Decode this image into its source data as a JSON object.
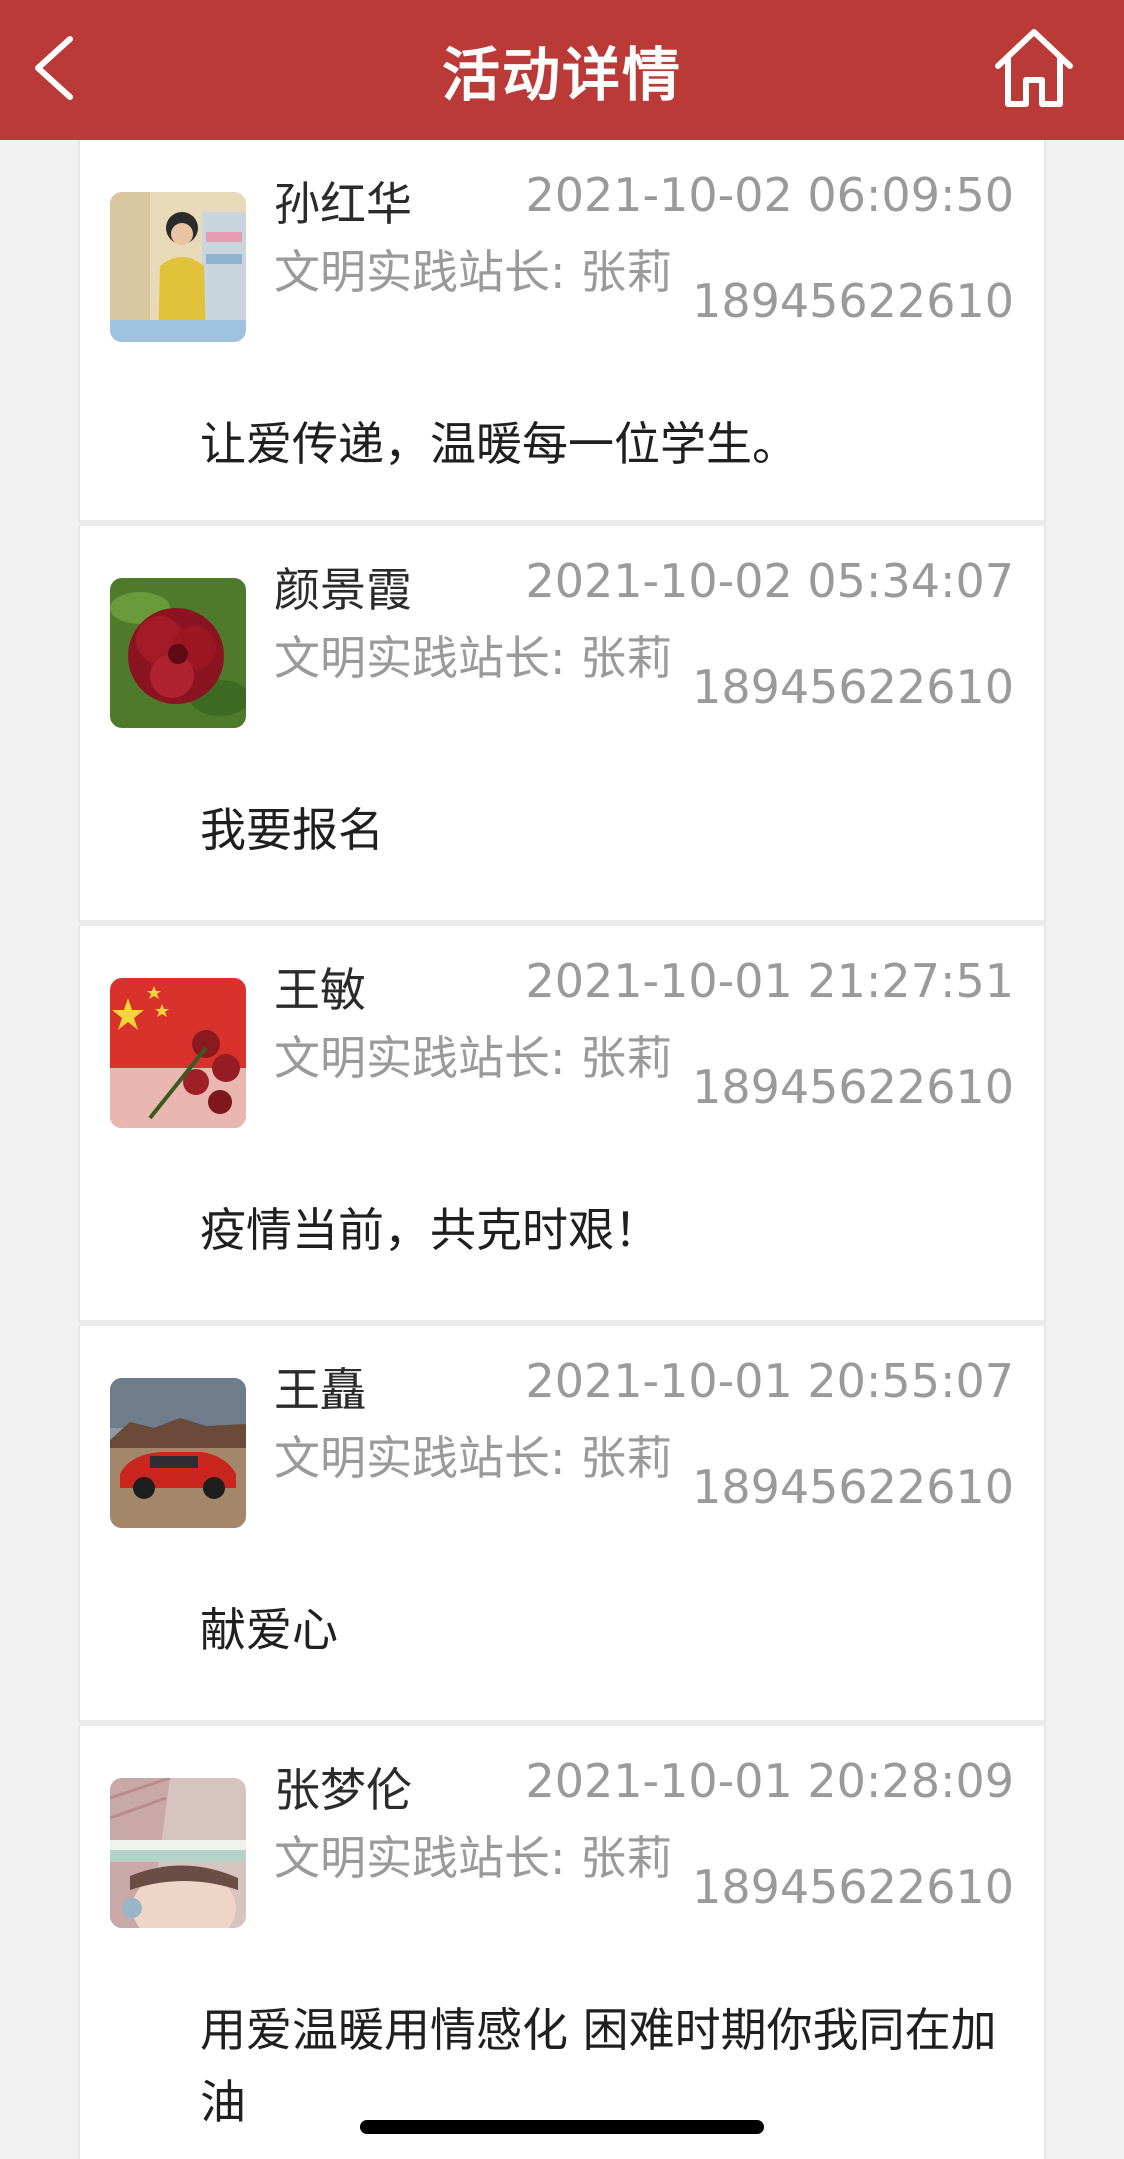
{
  "header": {
    "title": "活动详情",
    "back_icon": "chevron-left-icon",
    "home_icon": "home-icon",
    "color": "#b93a36"
  },
  "comments": [
    {
      "name": "孙红华",
      "time": "2021-10-02 06:09:50",
      "role": "文明实践站长: 张莉",
      "phone": "18945622610",
      "message": "让爱传递，温暖每一位学生。",
      "avatar": "woman-yellow-sweater-photo"
    },
    {
      "name": "颜景霞",
      "time": "2021-10-02 05:34:07",
      "role": "文明实践站长: 张莉",
      "phone": "18945622610",
      "message": "我要报名",
      "avatar": "red-flower-photo"
    },
    {
      "name": "王敏",
      "time": "2021-10-01 21:27:51",
      "role": "文明实践站长: 张莉",
      "phone": "18945622610",
      "message": "疫情当前，共克时艰！",
      "avatar": "flag-and-roses-photo"
    },
    {
      "name": "王矗",
      "time": "2021-10-01 20:55:07",
      "role": "文明实践站长: 张莉",
      "phone": "18945622610",
      "message": "献爱心",
      "avatar": "red-car-photo"
    },
    {
      "name": "张梦伦",
      "time": "2021-10-01 20:28:09",
      "role": "文明实践站长: 张莉",
      "phone": "18945622610",
      "message": "用爱温暖用情感化 困难时期你我同在加油",
      "avatar": "girl-portrait-photo"
    }
  ]
}
